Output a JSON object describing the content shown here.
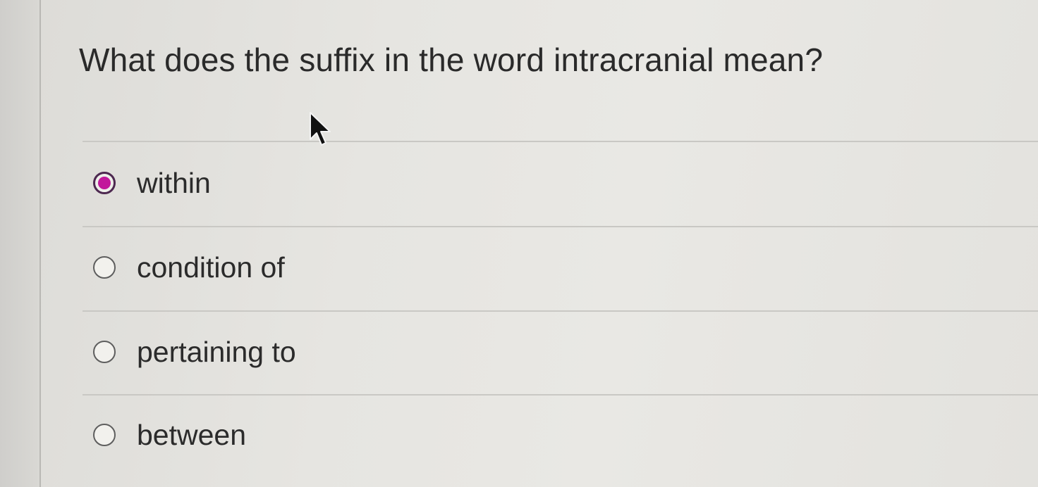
{
  "question": {
    "text": "What does the suffix in the word intracranial mean?"
  },
  "options": [
    {
      "label": "within",
      "selected": true
    },
    {
      "label": "condition of",
      "selected": false
    },
    {
      "label": "pertaining to",
      "selected": false
    },
    {
      "label": "between",
      "selected": false
    }
  ],
  "colors": {
    "selected_radio_fill": "#c2189b",
    "selected_radio_ring": "#4d2850",
    "text": "#2b2b2b"
  },
  "icons": {
    "pointer": "mouse-pointer-icon"
  }
}
